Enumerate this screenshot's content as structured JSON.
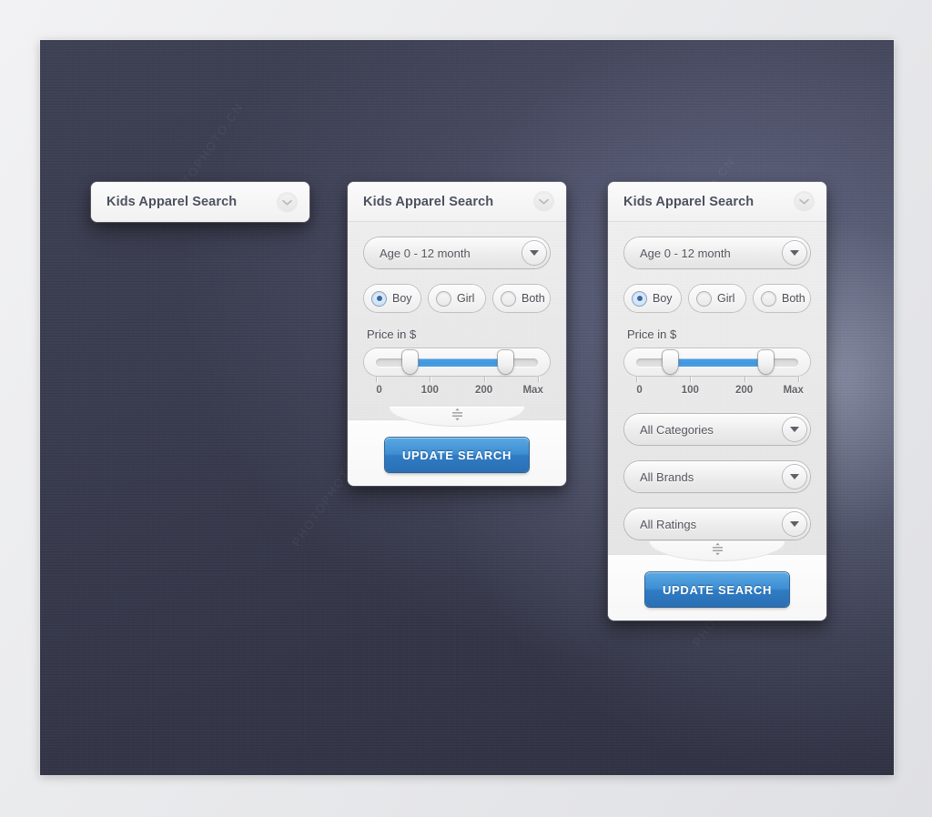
{
  "background": {
    "canvas_color": "#383a4e",
    "mat_color": "#eaebed",
    "accent_blue": "#3f97e0",
    "radio_dot_color": "#2f6ca8"
  },
  "watermarks": [
    "PHOTOPHOTO.CN",
    "PHOTOPHOTO.CN",
    "PHOTOPHOTO.CN",
    "PHOTOPHOTO.CN"
  ],
  "panels": [
    {
      "state": "collapsed",
      "title": "Kids Apparel Search",
      "collapse_icon": "chevron-down-icon"
    },
    {
      "state": "expanded-compact",
      "title": "Kids Apparel Search",
      "collapse_icon": "chevron-down-icon",
      "age_select": {
        "value": "Age 0 - 12 month",
        "icon": "caret-down-icon"
      },
      "gender": {
        "options": [
          {
            "label": "Boy",
            "selected": true
          },
          {
            "label": "Girl",
            "selected": false
          },
          {
            "label": "Both",
            "selected": false
          }
        ]
      },
      "price": {
        "label": "Price in $",
        "tick_labels": [
          "0",
          "100",
          "200",
          "Max"
        ],
        "min_percent": 21,
        "max_percent": 80
      },
      "resize_icon": "resize-vertical-grip-icon",
      "submit_label": "UPDATE SEARCH"
    },
    {
      "state": "expanded-full",
      "title": "Kids Apparel Search",
      "collapse_icon": "chevron-down-icon",
      "age_select": {
        "value": "Age 0 - 12 month",
        "icon": "caret-down-icon"
      },
      "gender": {
        "options": [
          {
            "label": "Boy",
            "selected": true
          },
          {
            "label": "Girl",
            "selected": false
          },
          {
            "label": "Both",
            "selected": false
          }
        ]
      },
      "price": {
        "label": "Price in $",
        "tick_labels": [
          "0",
          "100",
          "200",
          "Max"
        ],
        "min_percent": 21,
        "max_percent": 80
      },
      "filters": [
        {
          "value": "All Categories",
          "icon": "caret-down-icon"
        },
        {
          "value": "All Brands",
          "icon": "caret-down-icon"
        },
        {
          "value": "All Ratings",
          "icon": "caret-down-icon"
        }
      ],
      "resize_icon": "resize-vertical-grip-icon",
      "submit_label": "UPDATE SEARCH"
    }
  ]
}
